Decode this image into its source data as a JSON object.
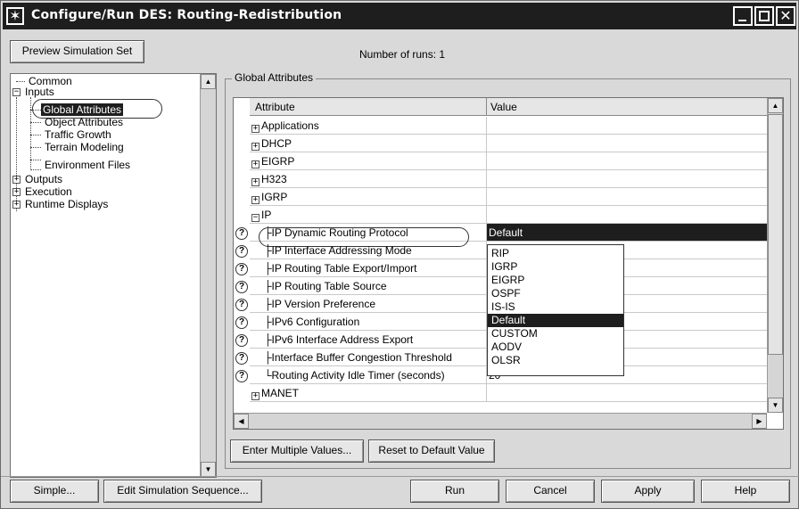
{
  "window": {
    "title": "Configure/Run DES: Routing-Redistribution"
  },
  "toolbar": {
    "preview_label": "Preview Simulation Set",
    "runs_text": "Number of runs: 1"
  },
  "tree": {
    "common": "Common",
    "inputs": "Inputs",
    "global_attributes": "Global Attributes",
    "object_attributes": "Object Attributes",
    "traffic_growth": "Traffic Growth",
    "terrain_modeling": "Terrain Modeling",
    "environment_files": "Environment Files",
    "outputs": "Outputs",
    "execution": "Execution",
    "runtime_displays": "Runtime Displays"
  },
  "group": {
    "title": "Global Attributes"
  },
  "table": {
    "col_attribute": "Attribute",
    "col_value": "Value",
    "rows": [
      {
        "label": "Applications",
        "value": ""
      },
      {
        "label": "DHCP",
        "value": ""
      },
      {
        "label": "EIGRP",
        "value": ""
      },
      {
        "label": "H323",
        "value": ""
      },
      {
        "label": "IGRP",
        "value": ""
      },
      {
        "label": "IP",
        "value": ""
      },
      {
        "label": "IP Dynamic Routing Protocol",
        "value": "Default"
      },
      {
        "label": "IP Interface Addressing Mode",
        "value": ""
      },
      {
        "label": "IP Routing Table Export/Import",
        "value": ""
      },
      {
        "label": "IP Routing Table Source",
        "value": ""
      },
      {
        "label": "IP Version Preference",
        "value": ""
      },
      {
        "label": "IPv6 Configuration",
        "value": ""
      },
      {
        "label": "IPv6 Interface Address Export",
        "value": ""
      },
      {
        "label": "Interface Buffer Congestion Threshold",
        "value": ""
      },
      {
        "label": "Routing Activity Idle Timer (seconds)",
        "value": "20"
      },
      {
        "label": "MANET",
        "value": ""
      }
    ]
  },
  "dropdown": {
    "options": [
      "RIP",
      "IGRP",
      "EIGRP",
      "OSPF",
      "IS-IS",
      "Default",
      "CUSTOM",
      "AODV",
      "OLSR"
    ],
    "selected": "Default"
  },
  "buttons": {
    "enter_multiple": "Enter Multiple Values...",
    "reset_default": "Reset to Default Value",
    "simple": "Simple...",
    "edit_sequence": "Edit Simulation Sequence...",
    "run": "Run",
    "cancel": "Cancel",
    "apply": "Apply",
    "help": "Help"
  },
  "icons": {
    "window": "opnet-star-icon",
    "help_marker": "question-circle-icon"
  }
}
